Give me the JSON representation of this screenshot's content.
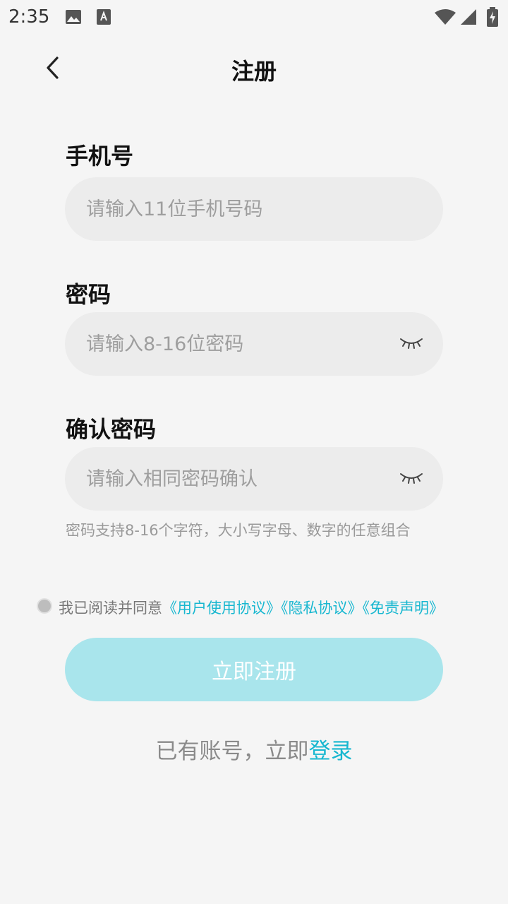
{
  "status_bar": {
    "time": "2:35"
  },
  "nav": {
    "title": "注册"
  },
  "form": {
    "phone": {
      "label": "手机号",
      "placeholder": "请输入11位手机号码"
    },
    "password": {
      "label": "密码",
      "placeholder": "请输入8-16位密码"
    },
    "confirm": {
      "label": "确认密码",
      "placeholder": "请输入相同密码确认"
    },
    "hint": "密码支持8-16个字符，大小写字母、数字的任意组合"
  },
  "agreement": {
    "prefix": "我已阅读并同意",
    "user_agreement": "《用户使用协议》",
    "privacy": "《隐私协议》",
    "disclaimer": "《免责声明》"
  },
  "submit_label": "立即注册",
  "login": {
    "prefix": "已有账号，立即",
    "link": "登录"
  },
  "colors": {
    "accent": "#17b7d0",
    "button_disabled": "#a9e5ec",
    "field_bg": "#ececec",
    "page_bg": "#f5f5f5"
  }
}
